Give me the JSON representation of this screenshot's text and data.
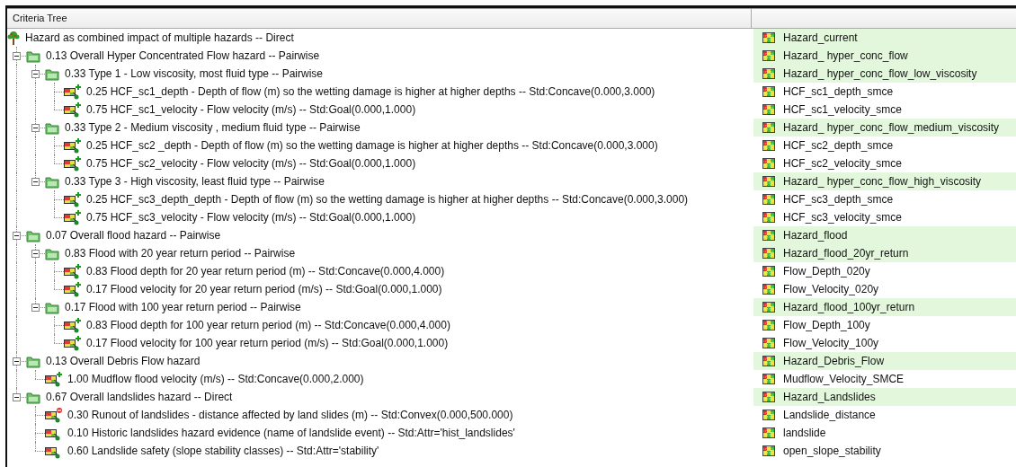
{
  "panel": {
    "columns": [
      "Criteria Tree"
    ]
  },
  "tree": [
    {
      "kind": "root",
      "label": "Hazard as combined impact of multiple hazards -- Direct",
      "output": "Hazard_current",
      "children": [
        {
          "kind": "group",
          "label": "0.13 Overall Hyper Concentrated  Flow hazard -- Pairwise",
          "output": "Hazard_ hyper_conc_flow",
          "expanded": true,
          "children": [
            {
              "kind": "group",
              "label": "0.33 Type 1 - Low viscosity, most fluid type -- Pairwise",
              "output": "Hazard_ hyper_conc_flow_low_viscosity",
              "expanded": true,
              "children": [
                {
                  "kind": "factor",
                  "benefit": true,
                  "cost": false,
                  "label": "0.25 HCF_sc1_depth - Depth of flow (m) so the wetting damage is higher at higher depths -- Std:Concave(0.000,3.000)",
                  "output": "HCF_sc1_depth_smce"
                },
                {
                  "kind": "factor",
                  "benefit": true,
                  "cost": false,
                  "label": "0.75 HCF_sc1_velocity - Flow velocity (m/s)  -- Std:Goal(0.000,1.000)",
                  "output": "HCF_sc1_velocity_smce"
                }
              ]
            },
            {
              "kind": "group",
              "label": "0.33 Type 2 - Medium viscosity , medium fluid type -- Pairwise",
              "output": "Hazard_ hyper_conc_flow_medium_viscosity",
              "expanded": true,
              "children": [
                {
                  "kind": "factor",
                  "benefit": true,
                  "cost": false,
                  "label": "0.25 HCF_sc2 _depth - Depth of flow (m) so the wetting damage is higher at higher depths -- Std:Concave(0.000,3.000)",
                  "output": "HCF_sc2_depth_smce"
                },
                {
                  "kind": "factor",
                  "benefit": true,
                  "cost": false,
                  "label": "0.75 HCF_sc2_velocity - Flow velocity (m/s)  -- Std:Goal(0.000,1.000)",
                  "output": "HCF_sc2_velocity_smce"
                }
              ]
            },
            {
              "kind": "group",
              "label": "0.33 Type 3 - High viscosity, least fluid type -- Pairwise",
              "output": "Hazard_ hyper_conc_flow_high_viscosity",
              "expanded": true,
              "children": [
                {
                  "kind": "factor",
                  "benefit": true,
                  "cost": false,
                  "label": "0.25 HCF_sc3_depth_depth - Depth of flow (m) so the wetting damage is higher at higher depths -- Std:Concave(0.000,3.000)",
                  "output": "HCF_sc3_depth_smce"
                },
                {
                  "kind": "factor",
                  "benefit": true,
                  "cost": false,
                  "label": "0.75 HCF_sc3_velocity - Flow velocity (m/s)  -- Std:Goal(0.000,1.000)",
                  "output": "HCF_sc3_velocity_smce"
                }
              ]
            }
          ]
        },
        {
          "kind": "group",
          "label": "0.07 Overall flood hazard -- Pairwise",
          "output": "Hazard_flood",
          "expanded": true,
          "children": [
            {
              "kind": "group",
              "label": "0.83 Flood with 20 year return period -- Pairwise",
              "output": "Hazard_flood_20yr_return",
              "expanded": true,
              "children": [
                {
                  "kind": "factor",
                  "benefit": true,
                  "cost": false,
                  "label": "0.83 Flood depth for 20 year return period (m) -- Std:Concave(0.000,4.000)",
                  "output": "Flow_Depth_020y"
                },
                {
                  "kind": "factor",
                  "benefit": true,
                  "cost": false,
                  "label": "0.17 Flood velocity for 20 year return period (m/s) -- Std:Goal(0.000,1.000)",
                  "output": "Flow_Velocity_020y"
                }
              ]
            },
            {
              "kind": "group",
              "label": "0.17 Flood with 100 year return period -- Pairwise",
              "output": "Hazard_flood_100yr_return",
              "expanded": true,
              "children": [
                {
                  "kind": "factor",
                  "benefit": true,
                  "cost": false,
                  "label": "0.83 Flood depth for 100 year return period (m) -- Std:Concave(0.000,4.000)",
                  "output": "Flow_Depth_100y"
                },
                {
                  "kind": "factor",
                  "benefit": true,
                  "cost": false,
                  "label": "0.17 Flood velocity for 100 year return period (m/s) -- Std:Goal(0.000,1.000)",
                  "output": "Flow_Velocity_100y"
                }
              ]
            }
          ]
        },
        {
          "kind": "group",
          "label": "0.13 Overall Debris Flow hazard",
          "output": "Hazard_Debris_Flow",
          "expanded": true,
          "children": [
            {
              "kind": "factor",
              "benefit": true,
              "cost": false,
              "label": "1.00 Mudflow flood velocity (m/s) -- Std:Concave(0.000,2.000)",
              "output": "Mudflow_Velocity_SMCE"
            }
          ]
        },
        {
          "kind": "group",
          "label": "0.67 Overall landslides hazard -- Direct",
          "output": "Hazard_Landslides",
          "expanded": true,
          "children": [
            {
              "kind": "factor",
              "benefit": false,
              "cost": true,
              "label": "0.30 Runout of landslides - distance affected by land slides (m) -- Std:Convex(0.000,500.000)",
              "output": "Landslide_distance"
            },
            {
              "kind": "factor",
              "benefit": false,
              "cost": false,
              "label": "0.10 Historic landslides hazard evidence (name of landslide event) -- Std:Attr='hist_landslides'",
              "output": "landslide"
            },
            {
              "kind": "factor",
              "benefit": false,
              "cost": false,
              "label": "0.60 Landslide safety  (slope stability classes) -- Std:Attr='stability'",
              "output": "open_slope_stability"
            }
          ]
        }
      ]
    }
  ]
}
